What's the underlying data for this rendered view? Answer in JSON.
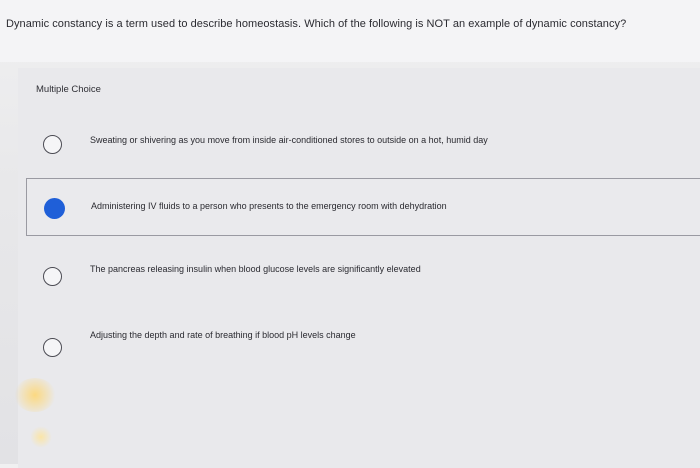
{
  "question": {
    "text": "Dynamic constancy is a term used to describe homeostasis. Which of the following is NOT an example of dynamic constancy?"
  },
  "section": {
    "label": "Multiple Choice"
  },
  "options": [
    {
      "text": "Sweating or shivering as you move from inside air-conditioned stores to outside on a hot, humid day",
      "selected": false
    },
    {
      "text": "Administering IV fluids to a person who presents to the emergency room with dehydration",
      "selected": true
    },
    {
      "text": "The pancreas releasing insulin when blood glucose levels are significantly elevated",
      "selected": false
    },
    {
      "text": "Adjusting the depth and rate of breathing if blood pH levels change",
      "selected": false
    }
  ],
  "colors": {
    "selected_radio": "#1f5fd8",
    "background": "#e9e9ec"
  }
}
